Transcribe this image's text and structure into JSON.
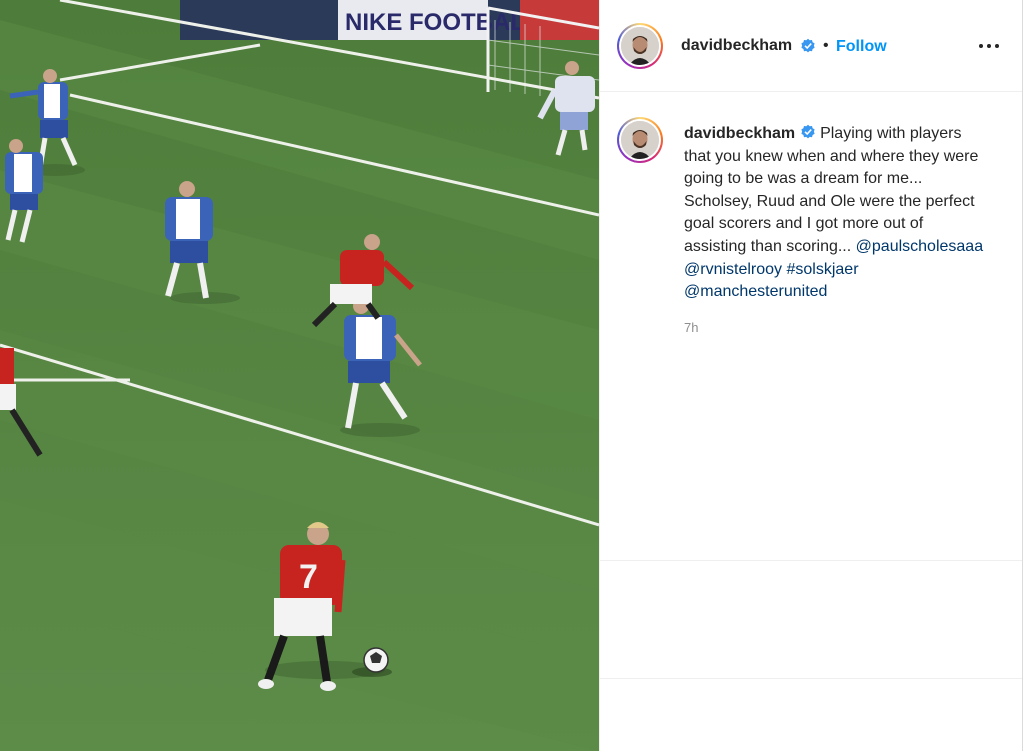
{
  "post": {
    "username": "davidbeckham",
    "follow_label": "Follow",
    "separator": "•",
    "caption_text_1": "Playing with players that you knew when and where they were going to be was a dream for me... Scholsey, Ruud and Ole were the perfect goal scorers and I got more out of assisting than scoring...",
    "mention_1": "@paulscholesaaa",
    "mention_2": "@rvnistelrooy",
    "hashtag_1": "#solskjaer",
    "mention_3": "@manchesterunited",
    "timestamp": "7h"
  },
  "media": {
    "ad_board_text": "NIKE FOOTBALL.COM",
    "player_number": "7"
  },
  "colors": {
    "follow": "#0095f6",
    "link": "#00376b",
    "pitch": "#4f7d3c",
    "verified": "#3897f0"
  },
  "icons": [
    "verified-badge-icon",
    "more-options-icon"
  ]
}
